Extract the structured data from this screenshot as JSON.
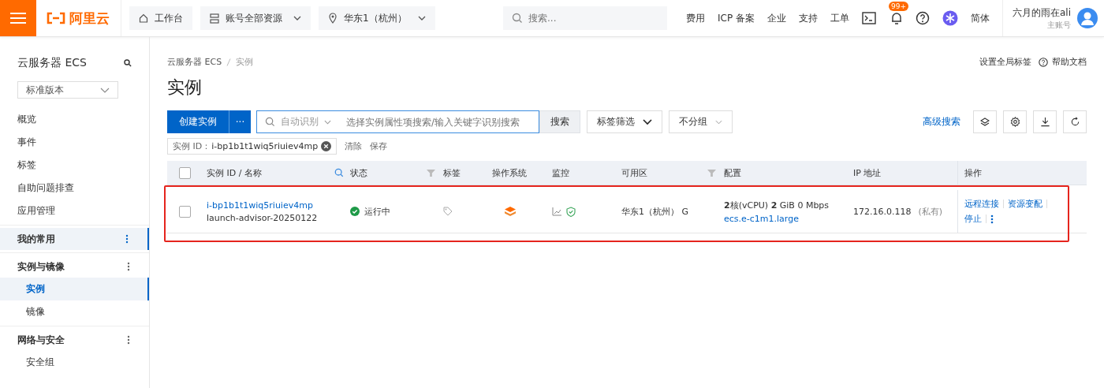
{
  "topbar": {
    "logo": "阿里云",
    "nav": [
      {
        "kind": "home",
        "label": "工作台"
      },
      {
        "kind": "list",
        "label": "账号全部资源"
      },
      {
        "kind": "location",
        "label": "华东1（杭州）"
      }
    ],
    "search": {
      "placeholder": "搜索..."
    },
    "links": [
      "费用",
      "ICP 备案",
      "企业",
      "支持",
      "工单"
    ],
    "badge": "99+",
    "language": "简体",
    "user": {
      "name": "六月的雨在ali",
      "role": "主账号"
    }
  },
  "sidebar": {
    "title": "云服务器 ECS",
    "version": "标准版本",
    "items": [
      {
        "label": "概览"
      },
      {
        "label": "事件"
      },
      {
        "label": "标签"
      },
      {
        "label": "自助问题排查"
      },
      {
        "label": "应用管理"
      }
    ],
    "groups": [
      {
        "label": "我的常用",
        "selected": true
      },
      {
        "label": "实例与镜像",
        "selected": false,
        "children": [
          {
            "label": "实例",
            "selected": true
          },
          {
            "label": "镜像",
            "selected": false
          }
        ]
      },
      {
        "label": "网络与安全",
        "selected": false,
        "children": [
          {
            "label": "安全组",
            "selected": false
          }
        ]
      }
    ]
  },
  "breadcrumb": [
    "云服务器 ECS",
    "实例"
  ],
  "header_links": [
    "设置全局标签",
    "帮助文档"
  ],
  "title": "实例",
  "toolbar": {
    "create": "创建实例",
    "more": "···",
    "search_mode": "自动识别",
    "search_placeholder": "选择实例属性项搜索/输入关键字识别搜索",
    "search_button": "搜索",
    "tag_filter": "标签筛选",
    "group": "不分组",
    "advanced": "高级搜索"
  },
  "filter": {
    "tag": "实例 ID：",
    "value": "i-bp1b1t1wiq5riuiev4mp",
    "clear": "清除",
    "save": "保存"
  },
  "table": {
    "all_checked": false,
    "columns": [
      "实例 ID / 名称",
      "状态",
      "标签",
      "操作系统",
      "监控",
      "可用区",
      "配置",
      "IP 地址",
      "操作"
    ],
    "rows": [
      {
        "checked": false,
        "id": "i-bp1b1t1wiq5riuiev4mp",
        "name": "launch-advisor-20250122",
        "status": "运行中",
        "zone": "华东1（杭州）  G",
        "config": "**2**核(vCPU)  **2** GiB  0 Mbps",
        "type": "ecs.e-c1m1.large",
        "ip": "172.16.0.118",
        "ip_kind": "(私有)",
        "actions": [
          "远程连接",
          "资源变配",
          "停止"
        ]
      }
    ]
  }
}
